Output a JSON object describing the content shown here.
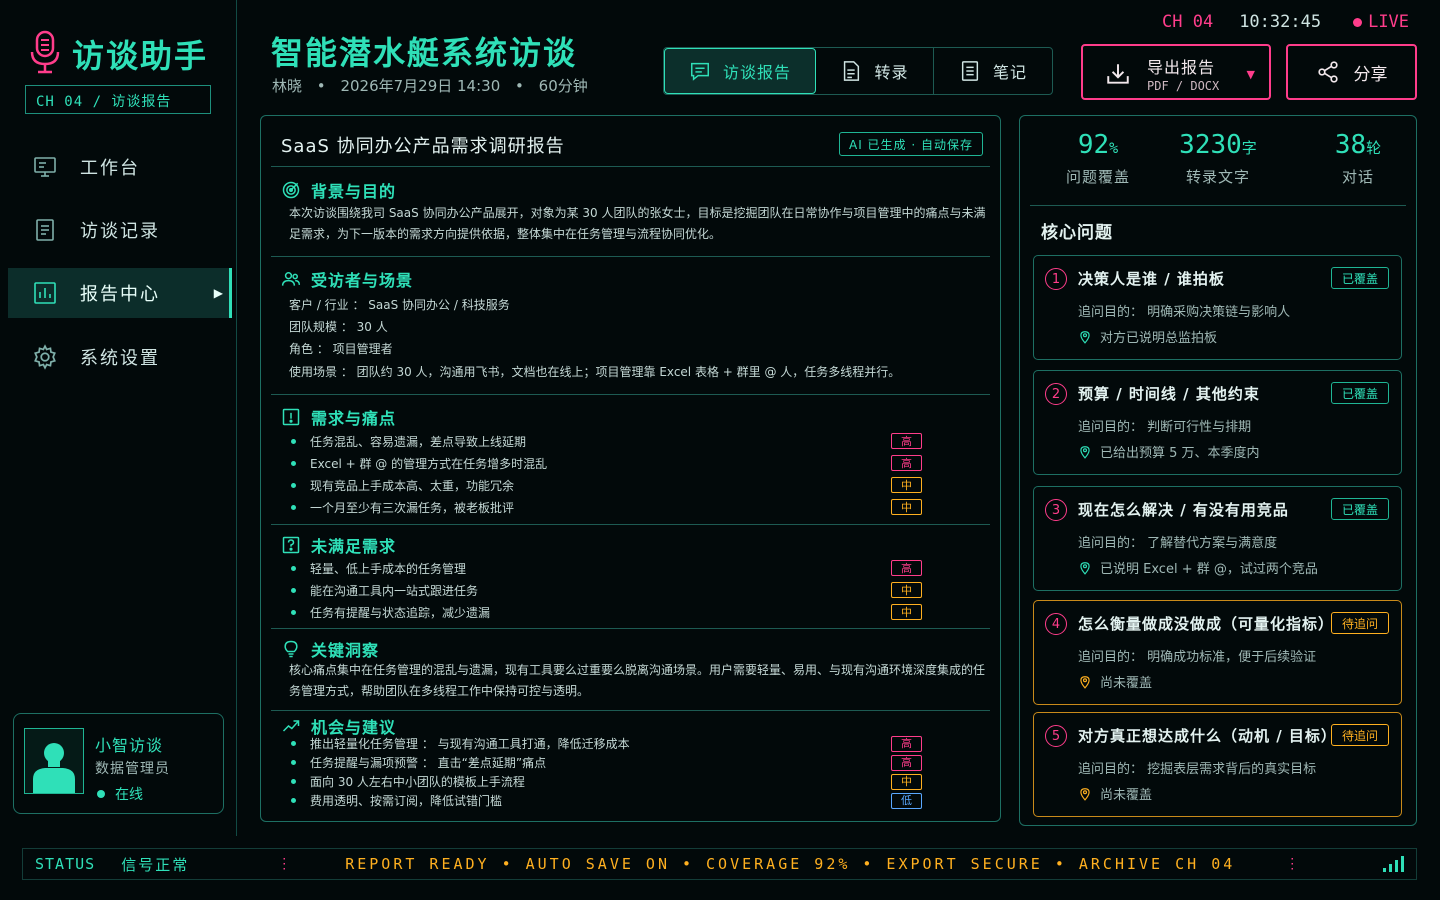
{
  "app": {
    "brand": "访谈助手",
    "channel_label": "CH 04 / 访谈报告"
  },
  "sidebar": {
    "items": [
      {
        "label": "工作台",
        "icon": "monitor-icon"
      },
      {
        "label": "访谈记录",
        "icon": "document-icon"
      },
      {
        "label": "报告中心",
        "icon": "chart-icon",
        "active": true
      },
      {
        "label": "系统设置",
        "icon": "gear-icon"
      }
    ]
  },
  "user": {
    "name": "小智访谈",
    "role": "数据管理员",
    "status": "在线"
  },
  "header": {
    "title": "智能潜水艇系统访谈",
    "interviewee": "林晓",
    "datetime": "2026年7月29日 14:30",
    "duration": "60分钟",
    "tabs": [
      {
        "label": "访谈报告",
        "active": true
      },
      {
        "label": "转录"
      },
      {
        "label": "笔记"
      }
    ],
    "live": {
      "channel": "CH 04",
      "time": "10:32:45",
      "tag": "LIVE"
    },
    "export": {
      "label": "导出报告",
      "formats": "PDF / DOCX"
    },
    "share_label": "分享"
  },
  "report": {
    "title": "SaaS 协同办公产品需求调研报告",
    "ai_badge": "AI 已生成 · 自动保存",
    "sections": {
      "background": {
        "title": "背景与目的",
        "text": "本次访谈围绕我司 SaaS 协同办公产品展开，对象为某 30 人团队的张女士，目标是挖掘团队在日常协作与项目管理中的痛点与未满足需求，为下一版本的需求方向提供依据，整体集中在任务管理与流程协同优化。"
      },
      "interviewee": {
        "title": "受访者与场景",
        "rows": [
          "客户 / 行业 ： SaaS 协同办公 / 科技服务",
          "团队规模 ： 30 人",
          "角色 ： 项目管理者",
          "使用场景 ： 团队约 30 人，沟通用飞书，文档也在线上；项目管理靠 Excel 表格 + 群里 @ 人，任务多线程并行。"
        ]
      },
      "pain_points": {
        "title": "需求与痛点",
        "items": [
          {
            "text": "任务混乱、容易遗漏，差点导致上线延期",
            "priority": "高",
            "level": "high"
          },
          {
            "text": "Excel + 群 @ 的管理方式在任务增多时混乱",
            "priority": "高",
            "level": "high"
          },
          {
            "text": "现有竞品上手成本高、太重，功能冗余",
            "priority": "中",
            "level": "mid"
          },
          {
            "text": "一个月至少有三次漏任务，被老板批评",
            "priority": "中",
            "level": "mid"
          }
        ]
      },
      "unmet": {
        "title": "未满足需求",
        "items": [
          {
            "text": "轻量、低上手成本的任务管理",
            "priority": "高",
            "level": "high"
          },
          {
            "text": "能在沟通工具内一站式跟进任务",
            "priority": "中",
            "level": "mid"
          },
          {
            "text": "任务有提醒与状态追踪，减少遗漏",
            "priority": "中",
            "level": "mid"
          }
        ]
      },
      "insight": {
        "title": "关键洞察",
        "text": "核心痛点集中在任务管理的混乱与遗漏，现有工具要么过重要么脱离沟通场景。用户需要轻量、易用、与现有沟通环境深度集成的任务管理方式，帮助团队在多线程工作中保持可控与透明。"
      },
      "opportunity": {
        "title": "机会与建议",
        "items": [
          {
            "text": "推出轻量化任务管理 ： 与现有沟通工具打通，降低迁移成本",
            "priority": "高",
            "level": "high"
          },
          {
            "text": "任务提醒与漏项预警 ： 直击“差点延期”痛点",
            "priority": "高",
            "level": "high"
          },
          {
            "text": "面向 30 人左右中小团队的模板上手流程",
            "priority": "中",
            "level": "mid"
          },
          {
            "text": "费用透明、按需订阅，降低试错门槛",
            "priority": "低",
            "level": "low"
          }
        ]
      }
    }
  },
  "stats": [
    {
      "value": "92",
      "unit": "%",
      "label": "问题覆盖"
    },
    {
      "value": "3230",
      "unit": "字",
      "label": "转录文字"
    },
    {
      "value": "38",
      "unit": "轮",
      "label": "对话"
    }
  ],
  "core": {
    "title": "核心问题",
    "questions": [
      {
        "num": "1",
        "title": "决策人是谁 / 谁拍板",
        "status": "已覆盖",
        "state": "covered",
        "purpose": "追问目的： 明确采购决策链与影响人",
        "note": "对方已说明总监拍板"
      },
      {
        "num": "2",
        "title": "预算 / 时间线 / 其他约束",
        "status": "已覆盖",
        "state": "covered",
        "purpose": "追问目的： 判断可行性与排期",
        "note": "已给出预算 5 万、本季度内"
      },
      {
        "num": "3",
        "title": "现在怎么解决 / 有没有用竞品",
        "status": "已覆盖",
        "state": "covered",
        "purpose": "追问目的： 了解替代方案与满意度",
        "note": "已说明 Excel + 群 @，试过两个竞品"
      },
      {
        "num": "4",
        "title": "怎么衡量做成没做成（可量化指标）",
        "status": "待追问",
        "state": "pending",
        "purpose": "追问目的： 明确成功标准，便于后续验证",
        "note": "尚未覆盖"
      },
      {
        "num": "5",
        "title": "对方真正想达成什么（动机 / 目标）",
        "status": "待追问",
        "state": "pending",
        "purpose": "追问目的： 挖掘表层需求背后的真实目标",
        "note": "尚未覆盖"
      }
    ]
  },
  "statusbar": {
    "label": "STATUS",
    "state": "信号正常",
    "ticker": [
      "REPORT READY",
      "AUTO SAVE ON",
      "COVERAGE 92%",
      "EXPORT SECURE",
      "ARCHIVE CH 04"
    ]
  },
  "colors": {
    "accent": "#2fe0b8",
    "alert": "#ff3d8b",
    "warning": "#ffb020",
    "info": "#5aa8ff",
    "background": "#02090a"
  }
}
